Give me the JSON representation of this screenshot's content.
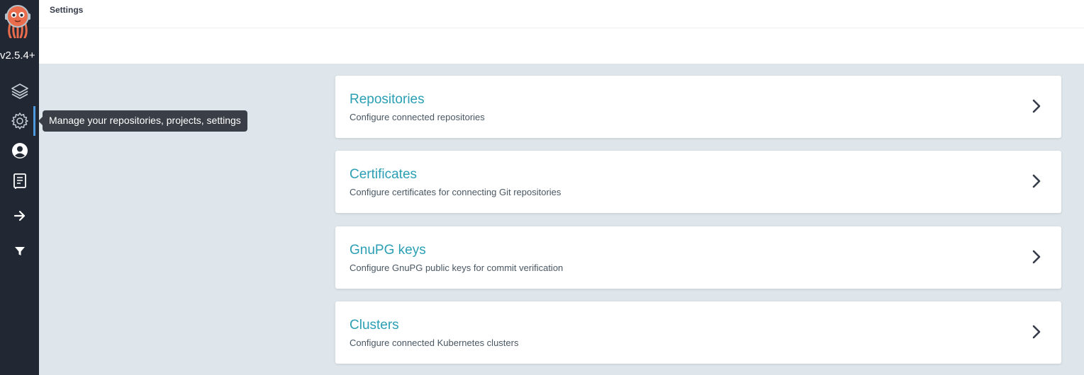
{
  "sidebar": {
    "version": "v2.5.4+",
    "items": [
      {
        "name": "applications",
        "icon": "layers-icon"
      },
      {
        "name": "settings",
        "icon": "gear-icon",
        "active": true
      },
      {
        "name": "user-info",
        "icon": "user-circle-icon"
      },
      {
        "name": "documentation",
        "icon": "book-icon"
      },
      {
        "name": "expand",
        "icon": "arrow-right-icon"
      },
      {
        "name": "filter",
        "icon": "filter-icon"
      }
    ],
    "active_color": "#4f9be0"
  },
  "header": {
    "title": "Settings"
  },
  "tooltip": {
    "text": "Manage your repositories, projects, settings"
  },
  "cards": [
    {
      "title": "Repositories",
      "description": "Configure connected repositories"
    },
    {
      "title": "Certificates",
      "description": "Configure certificates for connecting Git repositories"
    },
    {
      "title": "GnuPG keys",
      "description": "Configure GnuPG public keys for commit verification"
    },
    {
      "title": "Clusters",
      "description": "Configure connected Kubernetes clusters"
    }
  ],
  "colors": {
    "sidebar_bg": "#222833",
    "page_bg": "#dee6eb",
    "link": "#2a9fb4"
  }
}
